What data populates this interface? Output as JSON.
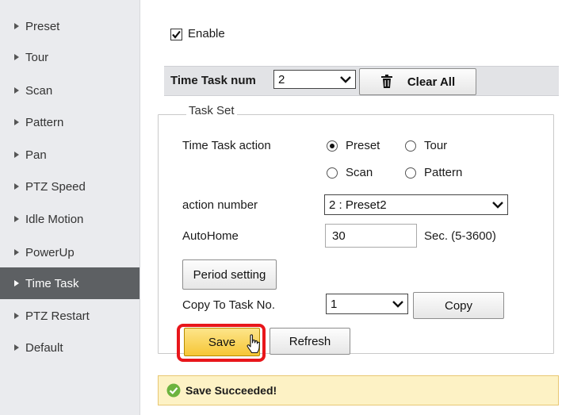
{
  "sidebar": {
    "items": [
      {
        "label": "Preset"
      },
      {
        "label": "Tour"
      },
      {
        "label": "Scan"
      },
      {
        "label": "Pattern"
      },
      {
        "label": "Pan"
      },
      {
        "label": "PTZ Speed"
      },
      {
        "label": "Idle Motion"
      },
      {
        "label": "PowerUp"
      },
      {
        "label": "Time Task",
        "active": true
      },
      {
        "label": "PTZ Restart"
      },
      {
        "label": "Default"
      }
    ]
  },
  "main": {
    "enable": {
      "label": "Enable",
      "checked": true
    },
    "time_task_num": {
      "label": "Time Task num",
      "value": "2"
    },
    "clear_all_label": "Clear All",
    "task_set": {
      "legend": "Task Set",
      "action_label": "Time Task action",
      "options": {
        "preset": "Preset",
        "tour": "Tour",
        "scan": "Scan",
        "pattern": "Pattern"
      },
      "selected_action": "Preset",
      "action_number_label": "action number",
      "action_number_value": "2 : Preset2",
      "autohome_label": "AutoHome",
      "autohome_value": "30",
      "autohome_unit": "Sec. (5-3600)",
      "period_button": "Period setting",
      "copy_label": "Copy To Task No.",
      "copy_value": "1",
      "copy_button": "Copy"
    },
    "save_label": "Save",
    "refresh_label": "Refresh",
    "status_message": "Save Succeeded!"
  },
  "colors": {
    "sidebar_bg": "#eaebee",
    "sidebar_active": "#5d6063",
    "save_button": "#f6c636",
    "highlight": "#e8161b",
    "status_bg": "#fdf2c5",
    "success_icon": "#6db33f"
  }
}
